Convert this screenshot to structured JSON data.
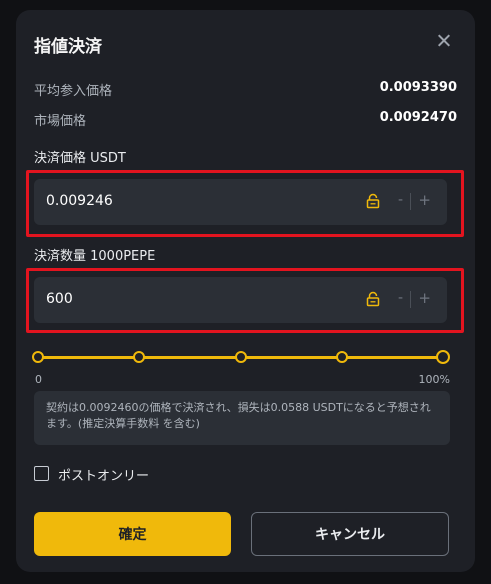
{
  "dialog": {
    "title": "指値決済",
    "close_icon": "close-icon"
  },
  "info": {
    "avg_entry_label": "平均参入価格",
    "avg_entry_value": "0.0093390",
    "market_label": "市場価格",
    "market_value": "0.0092470"
  },
  "price_field": {
    "label": "決済価格 USDT",
    "value": "0.009246",
    "lock_icon": "lock-icon",
    "minus": "-",
    "plus": "+"
  },
  "qty_field": {
    "label": "決済数量 1000PEPE",
    "value": "600",
    "lock_icon": "lock-icon",
    "minus": "-",
    "plus": "+"
  },
  "slider": {
    "min_label": "0",
    "max_label": "100%",
    "value_percent": 100,
    "accent": "#f0b90b"
  },
  "note": {
    "text": "契約は0.0092460の価格で決済され、損失は0.0588 USDTになると予想されます。(推定決算手数料 を含む)"
  },
  "post_only": {
    "label": "ポストオンリー",
    "checked": false
  },
  "buttons": {
    "confirm": "確定",
    "cancel": "キャンセル"
  },
  "colors": {
    "accent": "#f0b90b",
    "highlight_frame": "#e3141f",
    "panel": "#1e2026",
    "field": "#2b2f36"
  }
}
